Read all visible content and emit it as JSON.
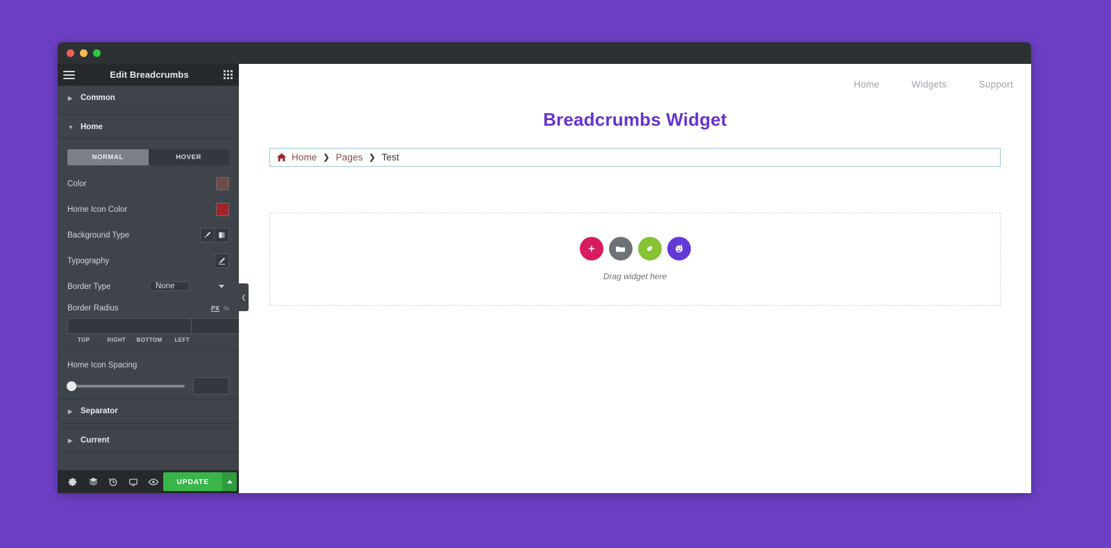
{
  "theme": {
    "page_background": "#6b3fc4",
    "panel_background": "#3f444b",
    "panel_dark": "#26292c",
    "accent_green": "#39b54a",
    "title_color": "#6633cc"
  },
  "window": {
    "traffic_lights": [
      "close-red",
      "minimize-yellow",
      "maximize-green"
    ]
  },
  "panel": {
    "header": {
      "menu_icon": "hamburger-icon",
      "title": "Edit Breadcrumbs",
      "widgets_icon": "grid-icon"
    },
    "accordions": [
      {
        "label": "Common",
        "expanded": false
      },
      {
        "label": "Home",
        "expanded": true
      },
      {
        "label": "Separator",
        "expanded": false
      },
      {
        "label": "Current",
        "expanded": false
      }
    ],
    "home_section": {
      "tabs": [
        {
          "label": "NORMAL",
          "active": true
        },
        {
          "label": "HOVER",
          "active": false
        }
      ],
      "controls": {
        "color_label": "Color",
        "color_value": "#6e4a46",
        "home_icon_color_label": "Home Icon Color",
        "home_icon_color_value": "#a32227",
        "background_type_label": "Background Type",
        "background_type_options": [
          "brush-icon",
          "gradient-icon"
        ],
        "typography_label": "Typography",
        "typography_icon": "pencil-icon",
        "border_type_label": "Border Type",
        "border_type_value": "None",
        "border_radius_label": "Border Radius",
        "border_radius_units": {
          "active": "PX",
          "alt": "%"
        },
        "border_radius_values": [
          "",
          "",
          "",
          ""
        ],
        "border_radius_sides": [
          "TOP",
          "RIGHT",
          "BOTTOM",
          "LEFT"
        ],
        "link_values_icon": "link-icon",
        "home_icon_spacing_label": "Home Icon Spacing",
        "home_icon_spacing_value": "",
        "home_icon_spacing_percent": 0
      }
    },
    "footer": {
      "icons": [
        "settings-gear-icon",
        "navigator-layers-icon",
        "history-clock-icon",
        "responsive-monitor-icon",
        "preview-eye-icon"
      ],
      "update_label": "UPDATE",
      "update_caret_icon": "chevron-up-icon"
    },
    "collapse_handle_icon": "chevron-left-icon"
  },
  "canvas": {
    "site_nav": [
      {
        "label": "Home"
      },
      {
        "label": "Widgets"
      },
      {
        "label": "Support"
      }
    ],
    "page_title": "Breadcrumbs Widget",
    "breadcrumbs": {
      "home_icon": "home-house-icon",
      "items": [
        {
          "label": "Home",
          "type": "link"
        },
        {
          "label": "Pages",
          "type": "link"
        },
        {
          "label": "Test",
          "type": "current"
        }
      ],
      "separator": "❯"
    },
    "dropzone": {
      "buttons": [
        {
          "name": "add-element-button",
          "icon": "plus-icon",
          "color": "#d81b60"
        },
        {
          "name": "add-folder-button",
          "icon": "folder-icon",
          "color": "#6d7278"
        },
        {
          "name": "add-template-button",
          "icon": "leaf-icon",
          "color": "#86c232"
        },
        {
          "name": "add-ai-button",
          "icon": "ai-face-icon",
          "color": "#6339d6"
        }
      ],
      "hint": "Drag widget here"
    }
  }
}
